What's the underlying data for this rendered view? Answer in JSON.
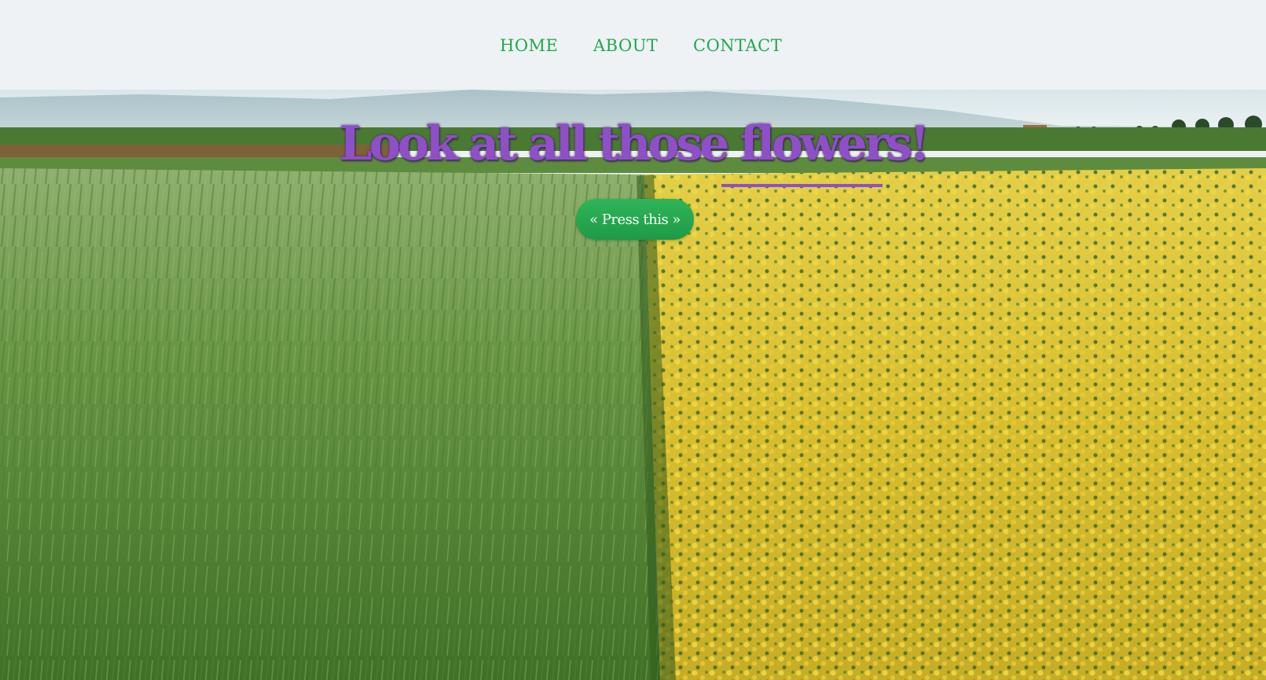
{
  "nav": {
    "items": [
      {
        "label": "HOME"
      },
      {
        "label": "ABOUT"
      },
      {
        "label": "CONTACT"
      }
    ]
  },
  "hero": {
    "headline": "Look at all those flowers!",
    "cta_label": "« Press this »",
    "image": "landscape-field-photo"
  },
  "colors": {
    "nav_background": "#eef2f4",
    "nav_link": "#23a64c",
    "headline": "#8f4fc8",
    "button": "#2aa753",
    "wheat": "#5f8f3a",
    "flowers": "#e8c93a"
  }
}
